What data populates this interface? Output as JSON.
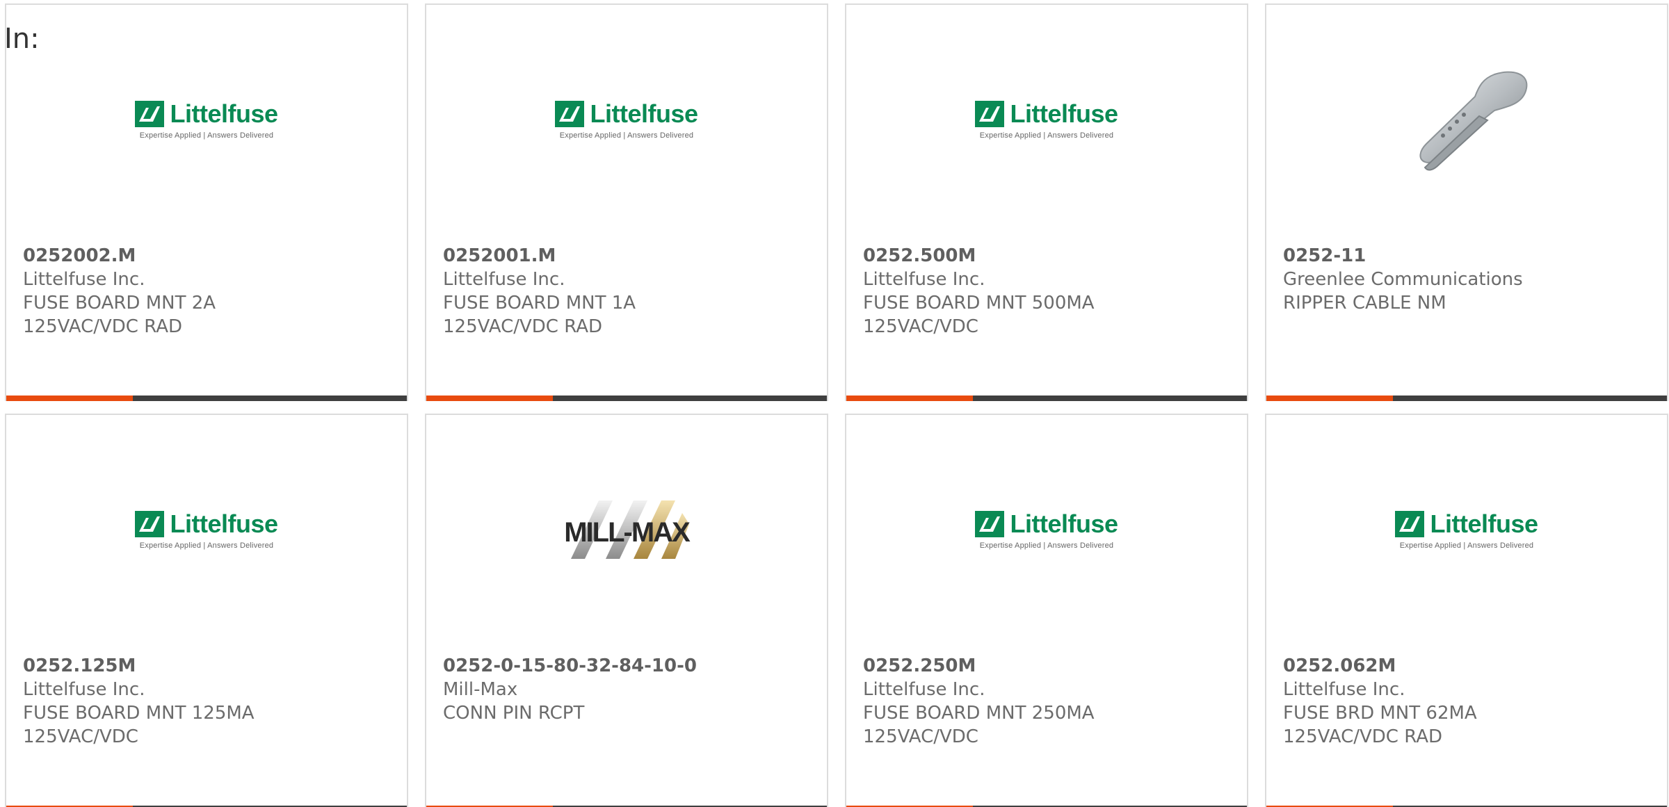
{
  "header": {
    "in_label": "In:"
  },
  "colors": {
    "accent": "#e84b0f",
    "bar": "#3f3f3f",
    "littelfuse_green": "#0a8a54"
  },
  "logos": {
    "littelfuse": {
      "name": "Littelfuse",
      "tagline": "Expertise Applied | Answers Delivered"
    },
    "millmax": {
      "name": "MILL-MAX"
    }
  },
  "products": [
    {
      "part": "0252002.M",
      "maker": "Littelfuse Inc.",
      "desc1": "FUSE BOARD MNT 2A",
      "desc2": "125VAC/VDC RAD",
      "image": "littelfuse-logo"
    },
    {
      "part": "0252001.M",
      "maker": "Littelfuse Inc.",
      "desc1": "FUSE BOARD MNT 1A",
      "desc2": "125VAC/VDC RAD",
      "image": "littelfuse-logo"
    },
    {
      "part": "0252.500M",
      "maker": "Littelfuse Inc.",
      "desc1": "FUSE BOARD MNT 500MA",
      "desc2": "125VAC/VDC",
      "image": "littelfuse-logo"
    },
    {
      "part": "0252-11",
      "maker": "Greenlee Communications",
      "desc1": "RIPPER CABLE NM",
      "desc2": "",
      "image": "cable-ripper-photo"
    },
    {
      "part": "0252.125M",
      "maker": "Littelfuse Inc.",
      "desc1": "FUSE BOARD MNT 125MA",
      "desc2": "125VAC/VDC",
      "image": "littelfuse-logo"
    },
    {
      "part": "0252-0-15-80-32-84-10-0",
      "maker": "Mill-Max",
      "desc1": "CONN PIN RCPT",
      "desc2": "",
      "image": "millmax-logo"
    },
    {
      "part": "0252.250M",
      "maker": "Littelfuse Inc.",
      "desc1": "FUSE BOARD MNT 250MA",
      "desc2": "125VAC/VDC",
      "image": "littelfuse-logo"
    },
    {
      "part": "0252.062M",
      "maker": "Littelfuse Inc.",
      "desc1": "FUSE BRD MNT 62MA",
      "desc2": "125VAC/VDC RAD",
      "image": "littelfuse-logo"
    }
  ]
}
